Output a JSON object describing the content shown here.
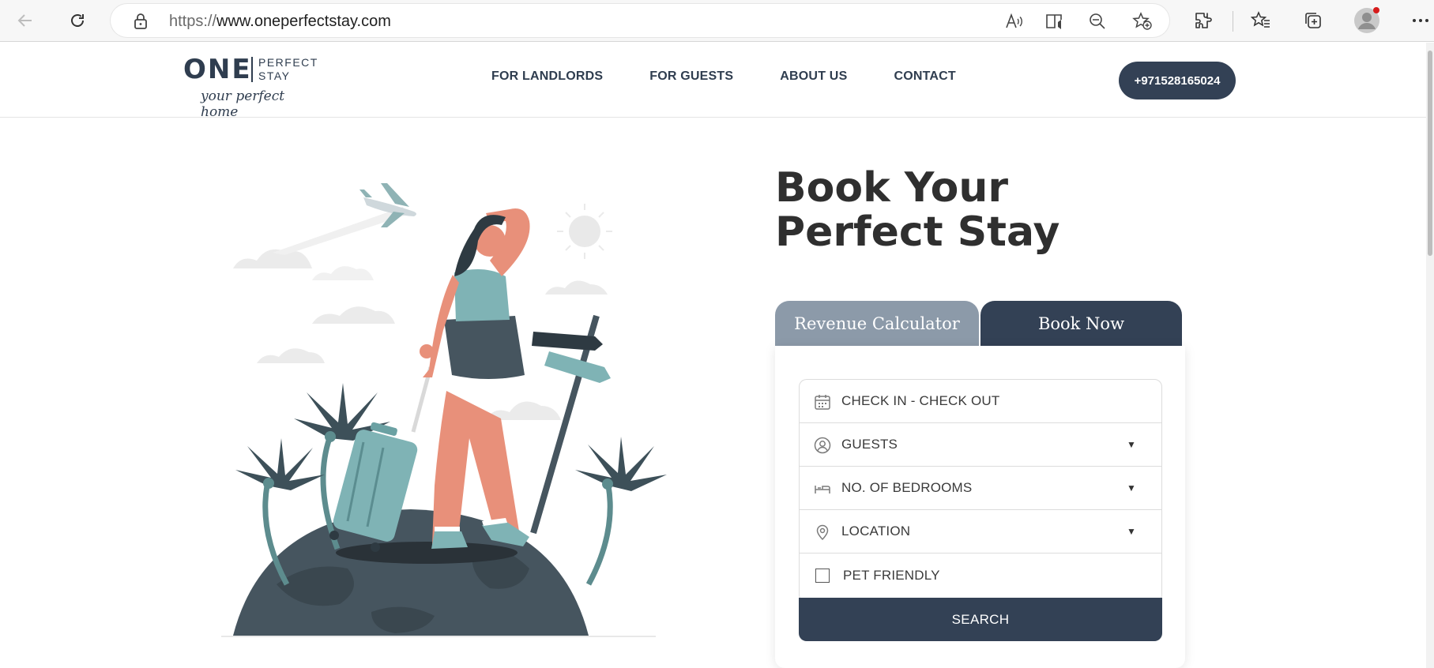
{
  "browser": {
    "url_scheme": "https://",
    "url_host": "www.oneperfectstay.com"
  },
  "header": {
    "logo_one": "ONE",
    "logo_perfect": "PERFECT",
    "logo_stay": "STAY",
    "logo_tagline": "your perfect home",
    "nav": [
      "FOR LANDLORDS",
      "FOR GUESTS",
      "ABOUT US",
      "CONTACT"
    ],
    "phone": "+971528165024"
  },
  "hero": {
    "title": "Book Your Perfect Stay"
  },
  "booking": {
    "tabs": [
      "Revenue Calculator",
      "Book Now"
    ],
    "active_tab": "Book Now",
    "fields": {
      "dates": "CHECK IN - CHECK OUT",
      "guests": "GUESTS",
      "bedrooms": "NO. OF BEDROOMS",
      "location": "LOCATION",
      "pet_friendly": "PET FRIENDLY"
    },
    "search_label": "SEARCH"
  },
  "colors": {
    "brand_dark": "#334155",
    "tab_inactive": "#8c9aa9",
    "illustration_teal": "#7fb3b5",
    "illustration_skin": "#e8907a"
  }
}
